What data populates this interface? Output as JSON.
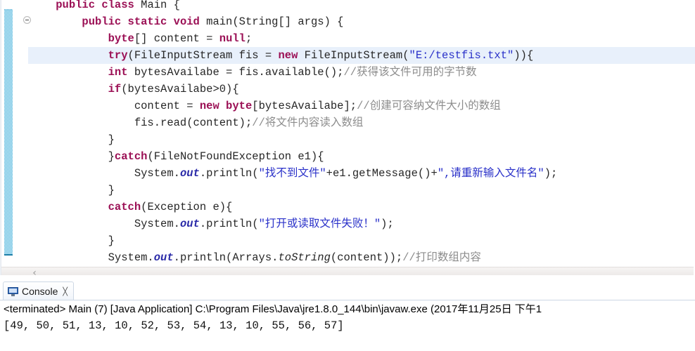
{
  "editor": {
    "name": "java-source-editor",
    "highlight_line_index": 3,
    "gutter": {
      "fold_icon": "collapse-fold-icon",
      "annotation_band_color": "#2ea8d8"
    },
    "scrollbar": {
      "left_arrow": "‹"
    },
    "colors": {
      "keyword": "#9b1055",
      "string": "#2a31c9",
      "comment": "#8c8c8c",
      "field": "#2a2aa8",
      "current_line": "#e8f0fb"
    },
    "lines": [
      [
        {
          "t": "    ",
          "c": "plain"
        },
        {
          "t": "public class ",
          "c": "kw"
        },
        {
          "t": "Main {",
          "c": "plain"
        }
      ],
      [
        {
          "t": "        ",
          "c": "plain"
        },
        {
          "t": "public static void ",
          "c": "kw"
        },
        {
          "t": "main(String[] args) {",
          "c": "plain"
        }
      ],
      [
        {
          "t": "            ",
          "c": "plain"
        },
        {
          "t": "byte",
          "c": "kw"
        },
        {
          "t": "[] content = ",
          "c": "plain"
        },
        {
          "t": "null",
          "c": "kw"
        },
        {
          "t": ";",
          "c": "plain"
        }
      ],
      [
        {
          "t": "            ",
          "c": "plain"
        },
        {
          "t": "try",
          "c": "kw"
        },
        {
          "t": "(FileInputStream fis = ",
          "c": "plain"
        },
        {
          "t": "new",
          "c": "kw"
        },
        {
          "t": " FileInputStream(",
          "c": "plain"
        },
        {
          "t": "\"E:/testfis.txt\"",
          "c": "str"
        },
        {
          "t": ")){",
          "c": "plain"
        }
      ],
      [
        {
          "t": "            ",
          "c": "plain"
        },
        {
          "t": "int",
          "c": "kw"
        },
        {
          "t": " bytesAvailabe = fis.available();",
          "c": "plain"
        },
        {
          "t": "//获得该文件可用的字节数",
          "c": "cmtg"
        }
      ],
      [
        {
          "t": "            ",
          "c": "plain"
        },
        {
          "t": "if",
          "c": "kw"
        },
        {
          "t": "(bytesAvailabe>0){",
          "c": "plain"
        }
      ],
      [
        {
          "t": "                content = ",
          "c": "plain"
        },
        {
          "t": "new byte",
          "c": "kw"
        },
        {
          "t": "[bytesAvailabe];",
          "c": "plain"
        },
        {
          "t": "//创建可容纳文件大小的数组",
          "c": "cmtg"
        }
      ],
      [
        {
          "t": "                fis.read(content);",
          "c": "plain"
        },
        {
          "t": "//将文件内容读入数组",
          "c": "cmtg"
        }
      ],
      [
        {
          "t": "            }",
          "c": "plain"
        }
      ],
      [
        {
          "t": "            }",
          "c": "plain"
        },
        {
          "t": "catch",
          "c": "kw"
        },
        {
          "t": "(FileNotFoundException e1){",
          "c": "plain"
        }
      ],
      [
        {
          "t": "                System.",
          "c": "plain"
        },
        {
          "t": "out",
          "c": "fld"
        },
        {
          "t": ".println(",
          "c": "plain"
        },
        {
          "t": "\"找不到文件\"",
          "c": "str"
        },
        {
          "t": "+e1.getMessage()+",
          "c": "plain"
        },
        {
          "t": "\",请重新输入文件名\"",
          "c": "str"
        },
        {
          "t": ");",
          "c": "plain"
        }
      ],
      [
        {
          "t": "            }",
          "c": "plain"
        }
      ],
      [
        {
          "t": "            ",
          "c": "plain"
        },
        {
          "t": "catch",
          "c": "kw"
        },
        {
          "t": "(Exception e){",
          "c": "plain"
        }
      ],
      [
        {
          "t": "                System.",
          "c": "plain"
        },
        {
          "t": "out",
          "c": "fld"
        },
        {
          "t": ".println(",
          "c": "plain"
        },
        {
          "t": "\"打开或读取文件失败！\"",
          "c": "str"
        },
        {
          "t": ");",
          "c": "plain"
        }
      ],
      [
        {
          "t": "            }",
          "c": "plain"
        }
      ],
      [
        {
          "t": "            System.",
          "c": "plain"
        },
        {
          "t": "out",
          "c": "fld"
        },
        {
          "t": ".println(Arrays.",
          "c": "plain"
        },
        {
          "t": "toString",
          "c": "mth"
        },
        {
          "t": "(content));",
          "c": "plain"
        },
        {
          "t": "//打印数组内容",
          "c": "cmtg"
        }
      ]
    ]
  },
  "console": {
    "tab_label": "Console",
    "tab_icon": "monitor-icon",
    "close_glyph": "╳",
    "launch_line": "<terminated> Main (7) [Java Application] C:\\Program Files\\Java\\jre1.8.0_144\\bin\\javaw.exe (2017年11月25日 下午1",
    "output_line": "[49, 50, 51, 13, 10, 52, 53, 54, 13, 10, 55, 56, 57]"
  }
}
